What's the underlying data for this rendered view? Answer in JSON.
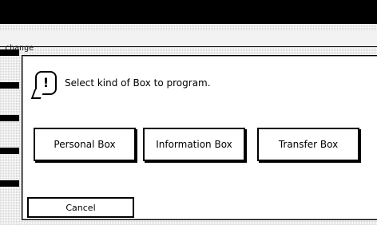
{
  "background": {
    "partial_label": "change"
  },
  "dialog": {
    "message": "Select kind of Box to program.",
    "icon": "alert-icon",
    "buttons": {
      "personal": "Personal Box",
      "information": "Information Box",
      "transfer": "Transfer Box"
    },
    "cancel": "Cancel"
  }
}
